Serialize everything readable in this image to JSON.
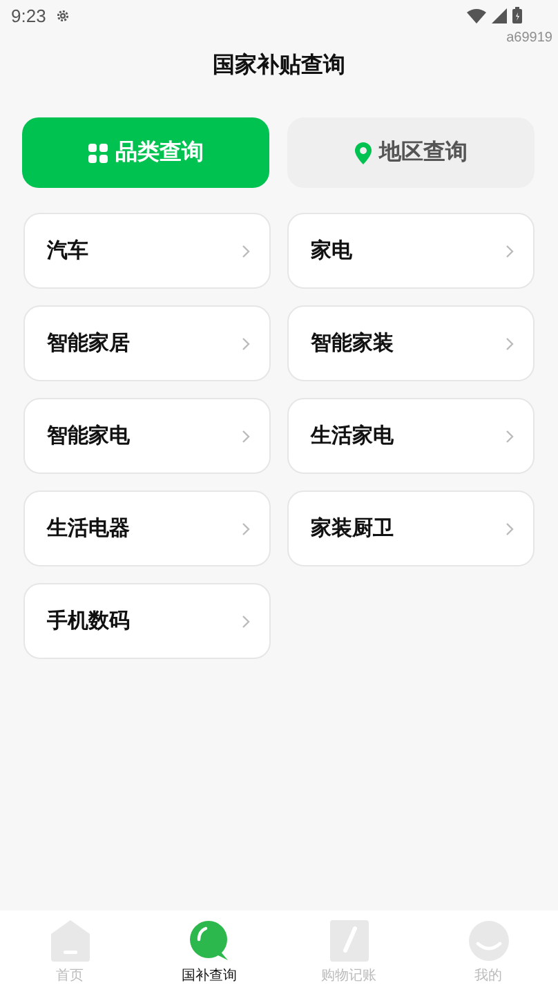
{
  "status_bar": {
    "time": "9:23"
  },
  "corner_code": "a69919",
  "title": "国家补贴查询",
  "modes": [
    {
      "label": "品类查询",
      "kind": "category",
      "selected": true
    },
    {
      "label": "地区查询",
      "kind": "region",
      "selected": false
    }
  ],
  "categories": [
    {
      "label": "汽车"
    },
    {
      "label": "家电"
    },
    {
      "label": "智能家居"
    },
    {
      "label": "智能家装"
    },
    {
      "label": "智能家电"
    },
    {
      "label": "生活家电"
    },
    {
      "label": "生活电器"
    },
    {
      "label": "家装厨卫"
    },
    {
      "label": "手机数码"
    }
  ],
  "nav": [
    {
      "label": "首页",
      "kind": "home",
      "selected": false
    },
    {
      "label": "国补查询",
      "kind": "search",
      "selected": true
    },
    {
      "label": "购物记账",
      "kind": "ledger",
      "selected": false
    },
    {
      "label": "我的",
      "kind": "profile",
      "selected": false
    }
  ]
}
